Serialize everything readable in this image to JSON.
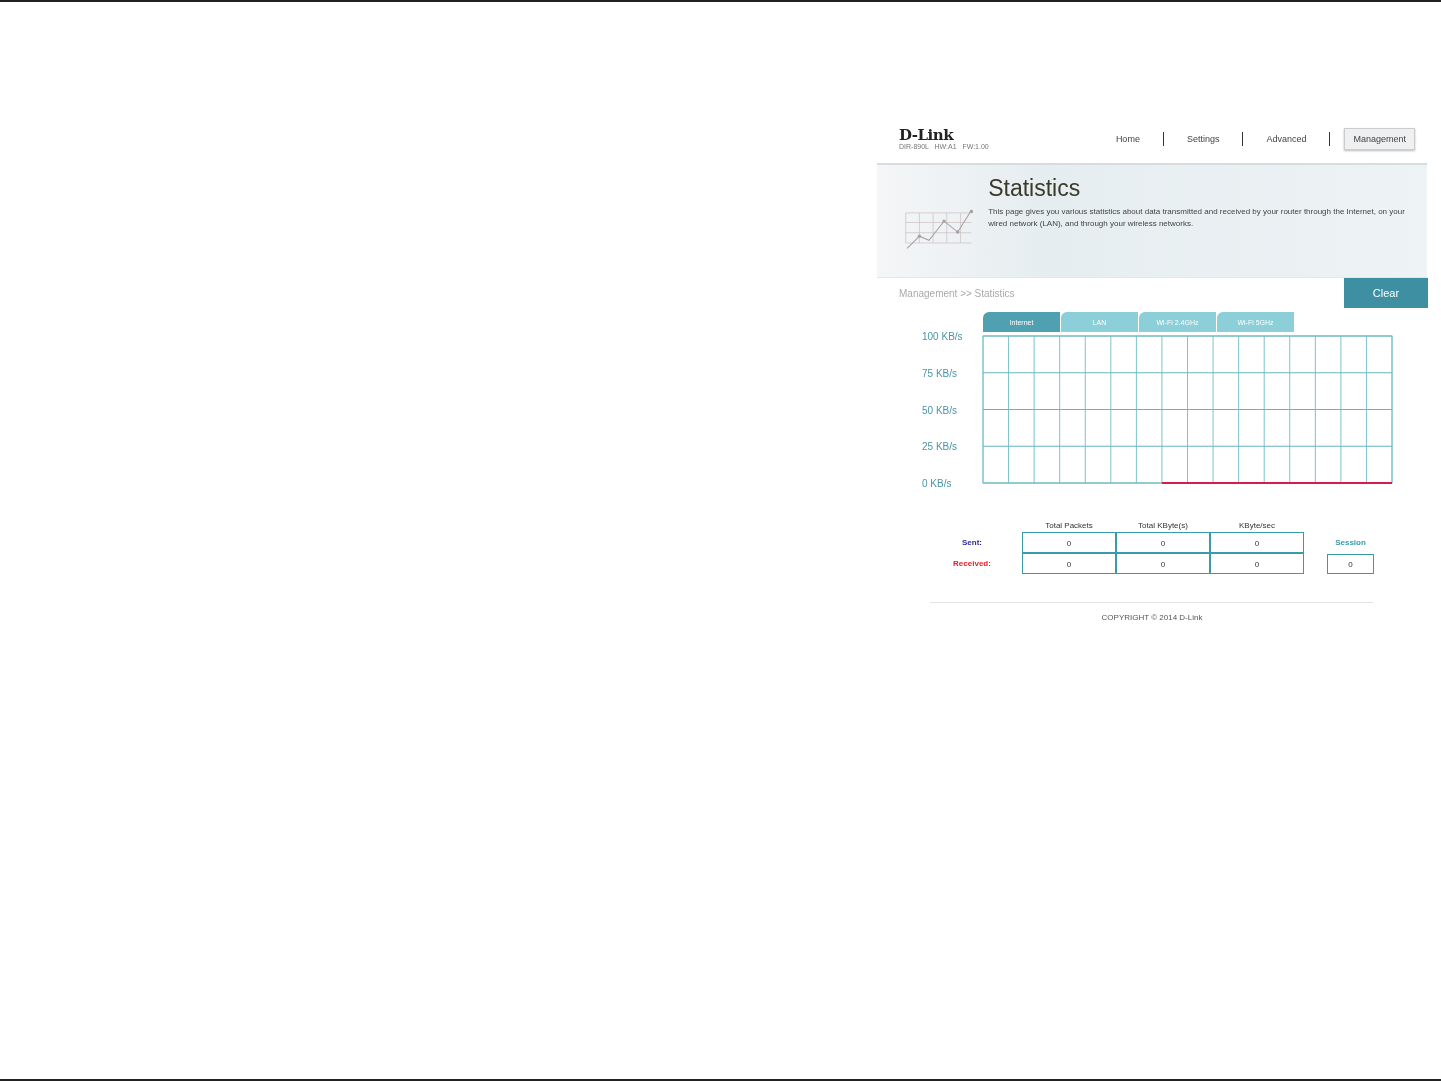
{
  "header": {
    "logo": "D-Link",
    "model_info": "DIR-890L   HW:A1   FW:1.00",
    "nav": [
      {
        "label": "Home",
        "selected": false
      },
      {
        "label": "Settings",
        "selected": false
      },
      {
        "label": "Advanced",
        "selected": false
      },
      {
        "label": "Management",
        "selected": true
      }
    ]
  },
  "banner": {
    "title": "Statistics",
    "description": "This page gives you various statistics about data transmitted and received by your router through the Internet, on your wired network (LAN), and through your wireless networks."
  },
  "breadcrumb": "Management >> Statistics",
  "clear_button": "Clear",
  "tabs": [
    {
      "label": "Internet",
      "selected": true
    },
    {
      "label": "LAN",
      "selected": false
    },
    {
      "label": "Wi-Fi 2.4GHz",
      "selected": false
    },
    {
      "label": "Wi-Fi 5GHz",
      "selected": false
    }
  ],
  "chart": {
    "chart_data": {
      "type": "line",
      "grid": true,
      "ylim": [
        0,
        100
      ],
      "yticks": [
        {
          "value": 0,
          "label": "0 KB/s"
        },
        {
          "value": 25,
          "label": "25 KB/s"
        },
        {
          "value": 50,
          "label": "50 KB/s"
        },
        {
          "value": 75,
          "label": "75 KB/s"
        },
        {
          "value": 100,
          "label": "100 KB/s"
        }
      ],
      "series": [
        {
          "color": "#d81b4a",
          "values": [
            null,
            null,
            null,
            null,
            null,
            null,
            null,
            0,
            0,
            0,
            0,
            0,
            0,
            0,
            0,
            0,
            0
          ]
        }
      ]
    }
  },
  "table": {
    "columns": [
      "Total Packets",
      "Total KByte(s)",
      "KByte/sec"
    ],
    "rows": [
      {
        "label": "Sent:",
        "color": "#2c2c9c",
        "cells": [
          "0",
          "0",
          "0"
        ]
      },
      {
        "label": "Received:",
        "color": "#e8202a",
        "cells": [
          "0",
          "0",
          "0"
        ]
      }
    ]
  },
  "session": {
    "label": "Session",
    "value": "0"
  },
  "footer": "COPYRIGHT © 2014 D-Link"
}
